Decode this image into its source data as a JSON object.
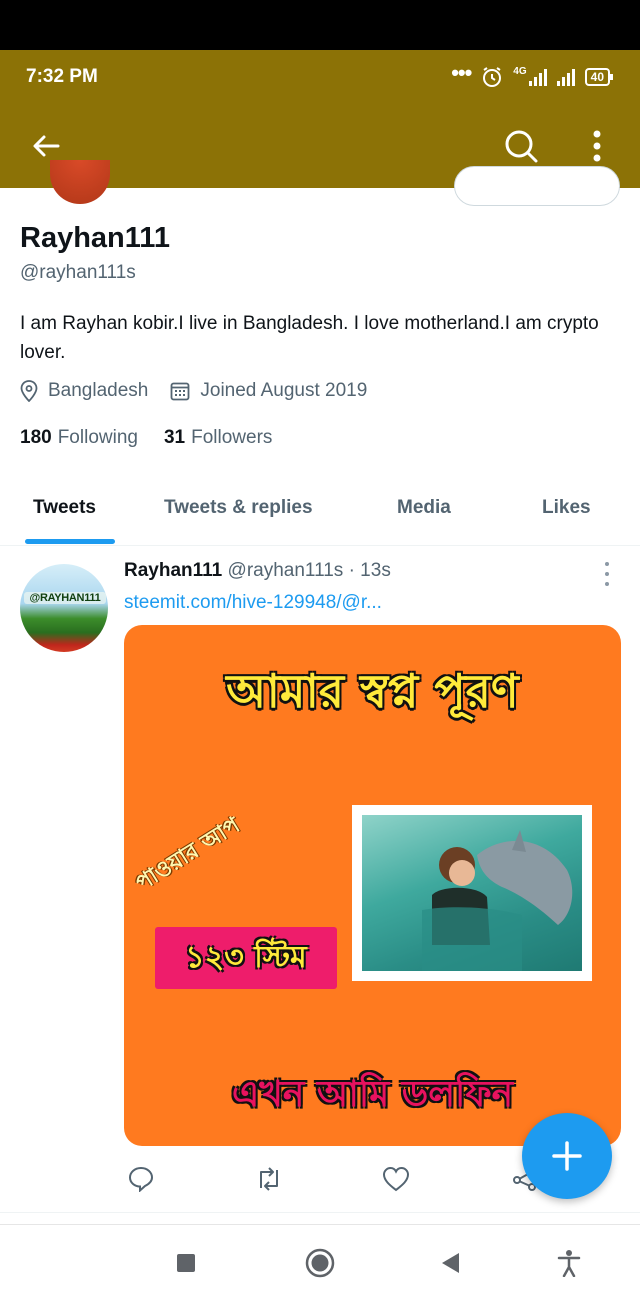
{
  "status_bar": {
    "time": "7:32 PM",
    "network": "4G",
    "battery": "40",
    "icons": [
      "more-dots-icon",
      "alarm-icon",
      "signal-icon",
      "signal-icon",
      "battery-icon"
    ]
  },
  "app_bar": {
    "back_icon": "arrow-left-icon",
    "search_icon": "search-icon",
    "menu_icon": "more-vertical-icon"
  },
  "profile": {
    "name": "Rayhan111",
    "handle": "@rayhan111s",
    "bio": "I am Rayhan kobir.I live in Bangladesh. I love motherland.I am crypto lover.",
    "location": "Bangladesh",
    "joined": "Joined August 2019",
    "following_count": "180",
    "following_label": "Following",
    "followers_count": "31",
    "followers_label": "Followers"
  },
  "tabs": [
    {
      "label": "Tweets",
      "active": true
    },
    {
      "label": "Tweets & replies",
      "active": false
    },
    {
      "label": "Media",
      "active": false
    },
    {
      "label": "Likes",
      "active": false
    }
  ],
  "tweet": {
    "author": "Rayhan111",
    "handle": "@rayhan111s",
    "time": "· 13s",
    "link": "steemit.com/hive-129948/@r...",
    "avatar_logo": "@RAYHAN111",
    "media": {
      "title": "আমার স্বপ্ন পূরণ",
      "diagonal": "পাওয়ার আপ",
      "badge": "১২৩ স্টিম",
      "footer": "এখন আমি ডলফিন"
    }
  },
  "colors": {
    "header": "#8c7206",
    "accent": "#1d9bf0",
    "media_bg": "#ff7a1f",
    "badge_bg": "#ee1d6b"
  }
}
